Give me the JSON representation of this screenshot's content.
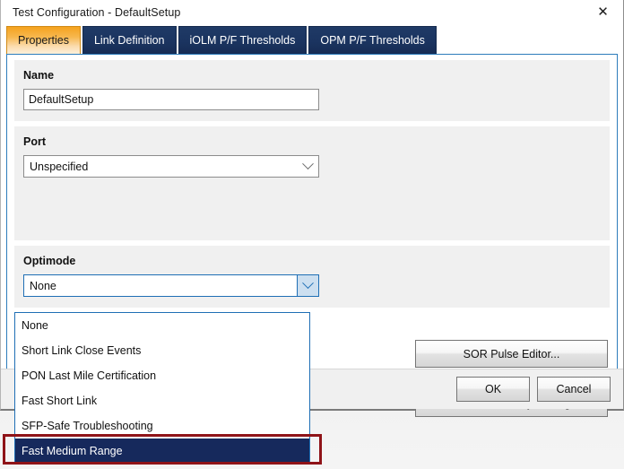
{
  "window": {
    "title": "Test Configuration - DefaultSetup",
    "close_icon": "close-icon",
    "close_glyph": "✕"
  },
  "tabs": [
    {
      "label": "Properties",
      "active": true
    },
    {
      "label": "Link Definition",
      "active": false
    },
    {
      "label": "iOLM P/F Thresholds",
      "active": false
    },
    {
      "label": "OPM P/F Thresholds",
      "active": false
    }
  ],
  "form": {
    "name": {
      "label": "Name",
      "value": "DefaultSetup",
      "placeholder": ""
    },
    "port": {
      "label": "Port",
      "value": "Unspecified",
      "chevron_icon": "chevron-down-icon"
    },
    "optimode": {
      "label": "Optimode",
      "value": "None",
      "chevron_icon": "chevron-down-icon",
      "open": true,
      "options": [
        "None",
        "Short Link Close Events",
        "PON Last Mile Certification",
        "Fast Short Link",
        "SFP-Safe Troubleshooting",
        "Fast Medium Range"
      ],
      "highlighted_option": "Fast Medium Range"
    }
  },
  "buttons": {
    "sor_pulse_editor": "SOR Pulse Editor...",
    "revert_to_factory": "Revert to Factory Settings",
    "ok": "OK",
    "cancel": "Cancel"
  },
  "annotation": {
    "color": "#8f1318",
    "target": "Fast Medium Range"
  },
  "colors": {
    "tab_active_start": "#f5a21e",
    "tab_inactive": "#1b3460",
    "panel_border": "#2d7cbb",
    "selection": "#16295c",
    "annotation_red": "#8f1318"
  }
}
